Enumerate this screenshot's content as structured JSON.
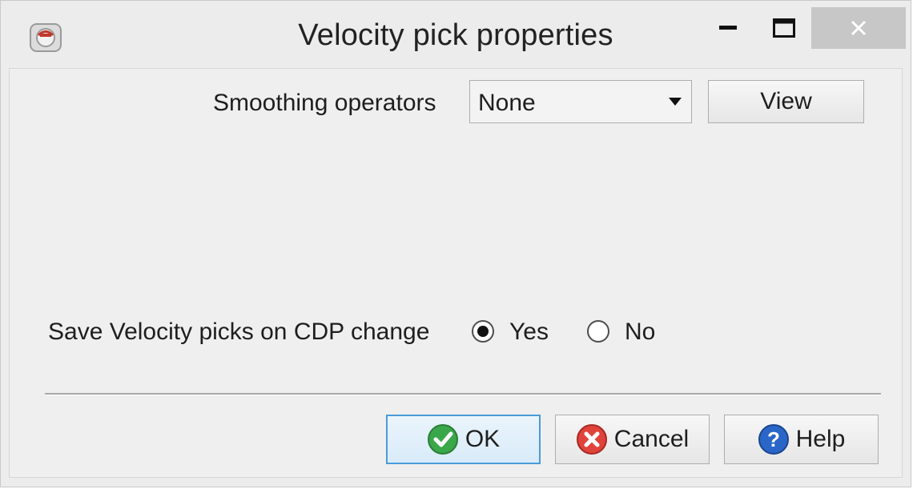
{
  "window": {
    "title": "Velocity pick properties",
    "app_icon": "app-logo-icon",
    "controls": {
      "minimize": "minimize-icon",
      "maximize": "maximize-icon",
      "close": "close-icon"
    }
  },
  "smoothing": {
    "label": "Smoothing operators",
    "selected": "None",
    "view_button": "View"
  },
  "save_picks": {
    "label": "Save Velocity picks on CDP change",
    "options": [
      {
        "label": "Yes",
        "checked": true
      },
      {
        "label": "No",
        "checked": false
      }
    ]
  },
  "buttons": {
    "ok": "OK",
    "cancel": "Cancel",
    "help": "Help"
  },
  "colors": {
    "ok_icon": "#3aa84a",
    "cancel_icon": "#e0433b",
    "help_icon": "#2a66c8",
    "focus_border": "#4a9bd8"
  }
}
